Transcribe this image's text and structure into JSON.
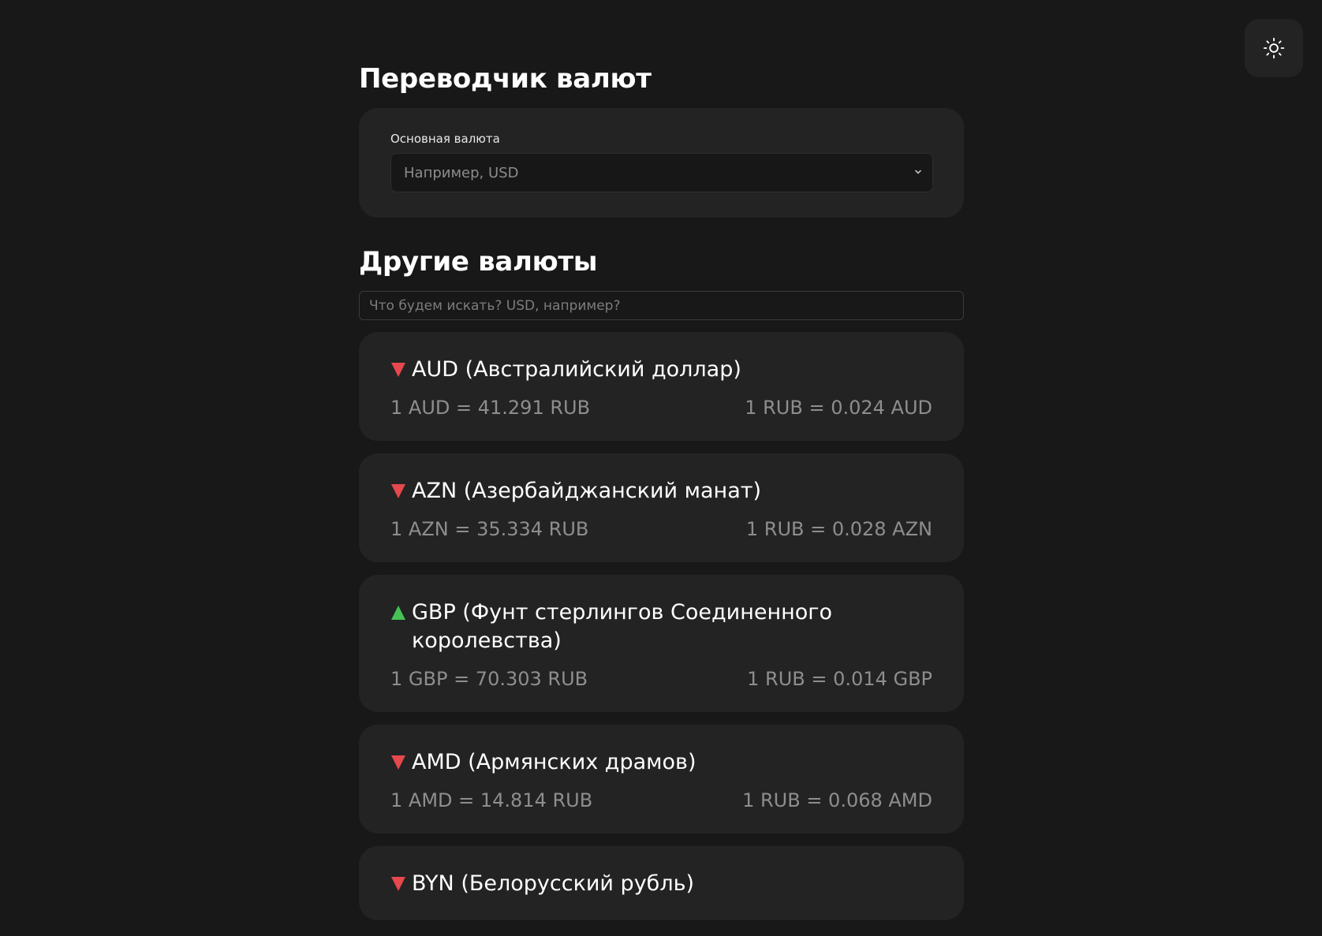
{
  "theme_toggle": {
    "icon": "sun-icon"
  },
  "converter": {
    "title": "Переводчик валют",
    "base_label": "Основная валюта",
    "base_placeholder": "Например, USD"
  },
  "others": {
    "title": "Другие валюты",
    "search_placeholder": "Что будем искать? USD, например?"
  },
  "colors": {
    "down": "#e5484d",
    "up": "#46c255",
    "card": "#232323",
    "background": "#181818"
  },
  "currencies": [
    {
      "trend": "down",
      "title": "AUD (Австралийский доллар)",
      "rate_to_rub": "1 AUD = 41.291 RUB",
      "rate_from_rub": "1 RUB = 0.024 AUD"
    },
    {
      "trend": "down",
      "title": "AZN (Азербайджанский манат)",
      "rate_to_rub": "1 AZN = 35.334 RUB",
      "rate_from_rub": "1 RUB = 0.028 AZN"
    },
    {
      "trend": "up",
      "title": "GBP (Фунт стерлингов Соединенного королевства)",
      "rate_to_rub": "1 GBP = 70.303 RUB",
      "rate_from_rub": "1 RUB = 0.014 GBP"
    },
    {
      "trend": "down",
      "title": "AMD (Армянских драмов)",
      "rate_to_rub": "1 AMD = 14.814 RUB",
      "rate_from_rub": "1 RUB = 0.068 AMD"
    },
    {
      "trend": "down",
      "title": "BYN (Белорусский рубль)",
      "rate_to_rub": "",
      "rate_from_rub": ""
    }
  ]
}
